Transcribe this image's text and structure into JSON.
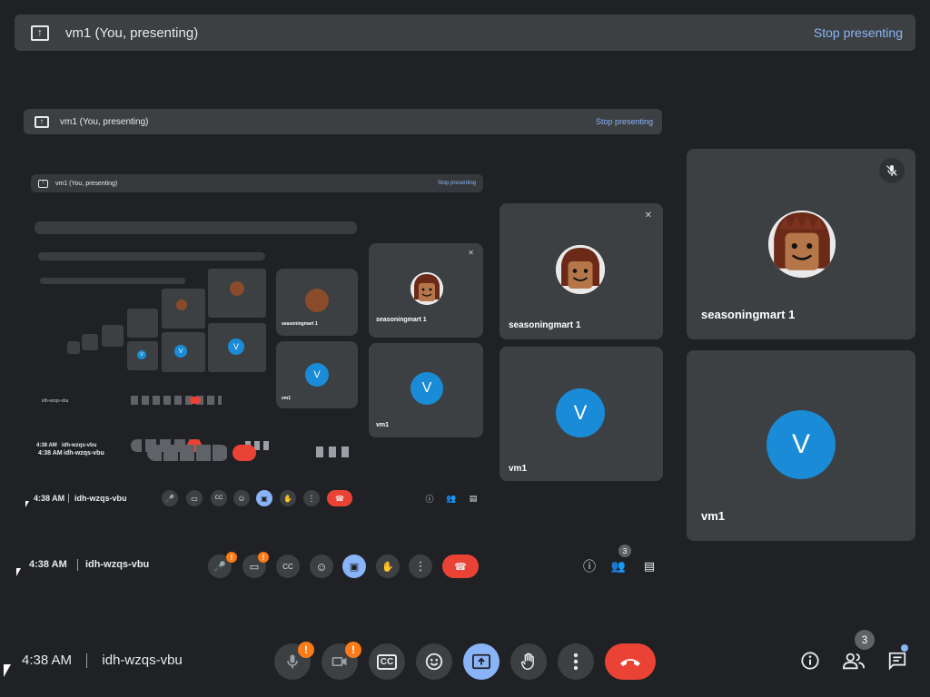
{
  "top_banner": {
    "title": "vm1 (You, presenting)",
    "stop_label": "Stop presenting"
  },
  "participants": [
    {
      "name": "seasoningmart 1",
      "muted": true
    },
    {
      "name": "vm1",
      "initial": "V"
    }
  ],
  "meeting": {
    "time": "4:38 AM",
    "code": "idh-wzqs-vbu"
  },
  "controls": {
    "mic_badge": "!",
    "cam_badge": "!",
    "people_count": "3"
  },
  "colors": {
    "background": "#202124",
    "tile": "#3c4043",
    "accent_blue": "#8ab4f8",
    "hangup_red": "#ea4335",
    "warning_orange": "#fa7b17",
    "avatar_blue": "#1a8bd6"
  },
  "icons": [
    "present-to-all-icon",
    "mic-off-icon",
    "videocam-off-icon",
    "captions-icon",
    "emoji-icon",
    "present-icon",
    "raise-hand-icon",
    "more-vert-icon",
    "call-end-icon",
    "info-icon",
    "people-icon",
    "chat-icon"
  ]
}
